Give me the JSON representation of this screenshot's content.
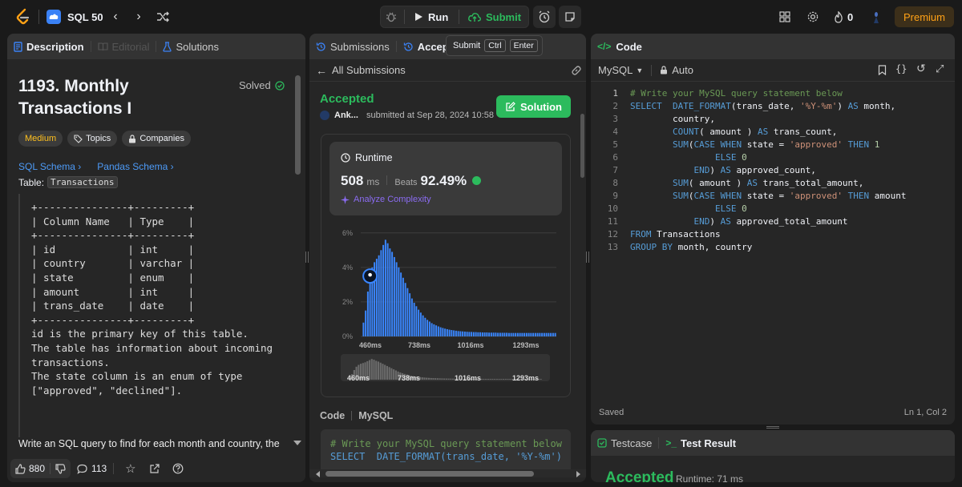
{
  "topbar": {
    "problem_list_label": "SQL 50",
    "run_label": "Run",
    "submit_label": "Submit",
    "streak_count": "0",
    "premium_label": "Premium"
  },
  "tooltip": {
    "label": "Submit",
    "key1": "Ctrl",
    "key2": "Enter"
  },
  "left": {
    "tabs": [
      "Description",
      "Editorial",
      "Solutions"
    ],
    "title_line1": "1193. Monthly",
    "title_line2": "Transactions I",
    "solved_label": "Solved",
    "difficulty": "Medium",
    "topics_label": "Topics",
    "companies_label": "Companies",
    "schema_links": [
      "SQL Schema",
      "Pandas Schema"
    ],
    "table_prefix": "Table:",
    "table_name": "Transactions",
    "schema_lines": [
      "+---------------+---------+",
      "| Column Name   | Type    |",
      "+---------------+---------+",
      "| id            | int     |",
      "| country       | varchar |",
      "| state         | enum    |",
      "| amount        | int     |",
      "| trans_date    | date    |",
      "+---------------+---------+",
      "id is the primary key of this table.",
      "The table has information about incoming",
      "transactions.",
      "The state column is an enum of type",
      "[\"approved\", \"declined\"]."
    ],
    "prompt_text": "Write an SQL query to find for each month and country, the",
    "likes": "880",
    "comments": "113"
  },
  "middle": {
    "tabs": [
      "Submissions",
      "Accept"
    ],
    "back_label": "All Submissions",
    "status": "Accepted",
    "user": "Ank...",
    "submitted_text": "submitted at Sep 28, 2024 10:58",
    "solution_label": "Solution",
    "runtime_label": "Runtime",
    "runtime_value": "508",
    "runtime_unit": "ms",
    "beats_label": "Beats",
    "beats_value": "92.49%",
    "analyze_label": "Analyze Complexity",
    "code_label": "Code",
    "code_lang": "MySQL",
    "code_preview": [
      "# Write your MySQL query statement below",
      "SELECT  DATE_FORMAT(trans_date, '%Y-%m')"
    ]
  },
  "chart_data": {
    "type": "bar",
    "yticks": [
      "6%",
      "4%",
      "2%",
      "0%"
    ],
    "ylim": [
      0,
      6.5
    ],
    "xticks": [
      "460ms",
      "738ms",
      "1016ms",
      "1293ms"
    ],
    "values": [
      0.8,
      1.5,
      2.6,
      3.5,
      4.0,
      4.3,
      4.5,
      4.7,
      5.0,
      5.3,
      5.6,
      5.4,
      5.1,
      4.9,
      4.6,
      4.3,
      4.0,
      3.7,
      3.4,
      3.1,
      2.8,
      2.5,
      2.2,
      1.95,
      1.75,
      1.55,
      1.38,
      1.22,
      1.08,
      0.96,
      0.86,
      0.77,
      0.7,
      0.64,
      0.58,
      0.53,
      0.49,
      0.45,
      0.42,
      0.39,
      0.37,
      0.35,
      0.33,
      0.31,
      0.3,
      0.29,
      0.28,
      0.27,
      0.26,
      0.26,
      0.25,
      0.25,
      0.24,
      0.24,
      0.23,
      0.23,
      0.23,
      0.22,
      0.22,
      0.22,
      0.22,
      0.21,
      0.21,
      0.21,
      0.21,
      0.21,
      0.2,
      0.2,
      0.2,
      0.2,
      0.2,
      0.2,
      0.2,
      0.2,
      0.2,
      0.2,
      0.2,
      0.2,
      0.2,
      0.2,
      0.2,
      0.2,
      0.2,
      0.2,
      0.2,
      0.2,
      0.2,
      0.2
    ],
    "highlight_index": 3,
    "bar_color": "#3a86ff",
    "highlight_color": "#ffffff"
  },
  "right": {
    "title": "Code",
    "lang": "MySQL",
    "mode": "Auto",
    "lines": [
      "# Write your MySQL query statement below",
      "SELECT  DATE_FORMAT(trans_date, '%Y-%m') AS month,",
      "        country,",
      "        COUNT( amount ) AS trans_count,",
      "        SUM(CASE WHEN state = 'approved' THEN 1",
      "                ELSE 0",
      "            END) AS approved_count,",
      "        SUM( amount ) AS trans_total_amount,",
      "        SUM(CASE WHEN state = 'approved' THEN amount",
      "                ELSE 0",
      "            END) AS approved_total_amount",
      "FROM Transactions",
      "GROUP BY month, country"
    ],
    "saved_label": "Saved",
    "cursor_pos": "Ln 1, Col 2",
    "testcase_label": "Testcase",
    "result_label": "Test Result",
    "result_status": "Accepted",
    "result_runtime": "Runtime: 71 ms"
  }
}
